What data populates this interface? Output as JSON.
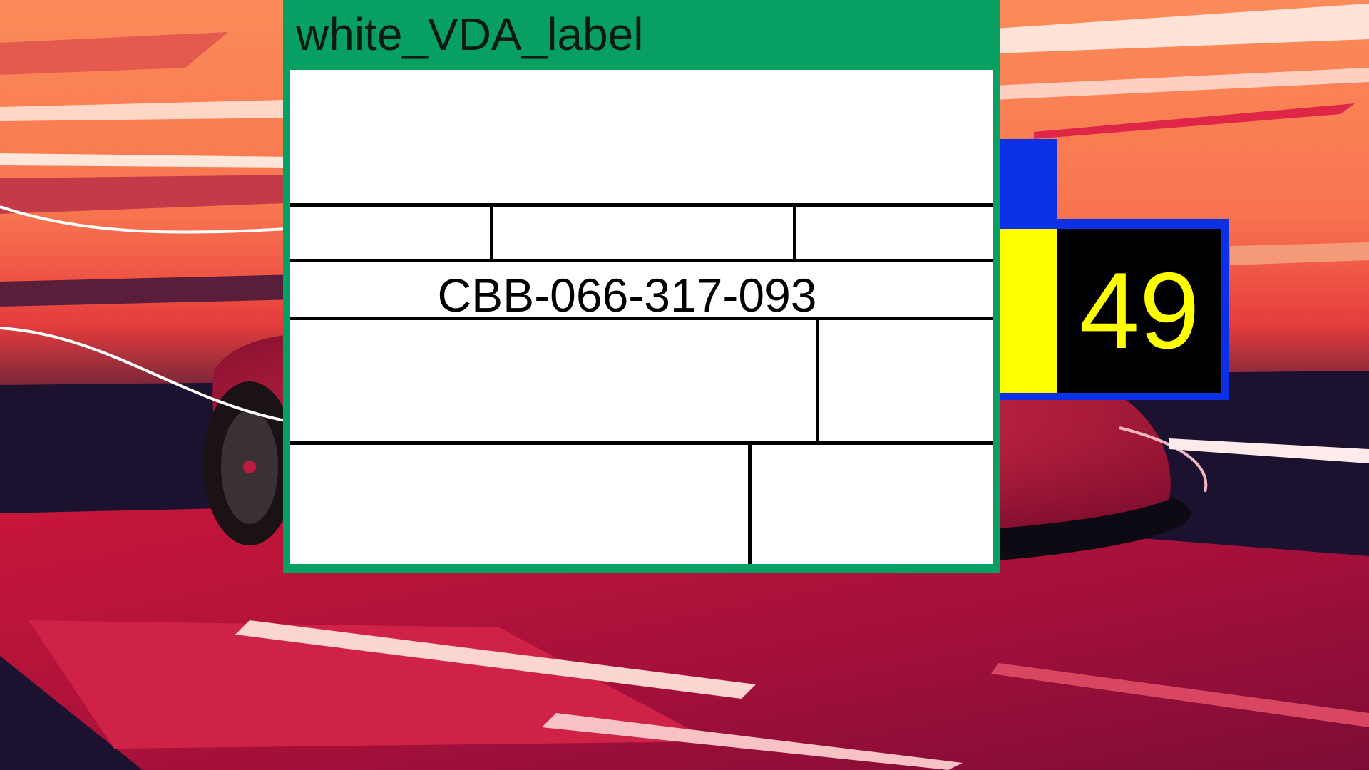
{
  "label": {
    "title": "white_VDA_label",
    "serial": "CBB-066-317-093"
  },
  "badge": {
    "number": "49"
  },
  "colors": {
    "panel_green": "#08a062",
    "badge_blue": "#0b30e6",
    "badge_yellow": "#ffff00",
    "badge_black": "#000000",
    "card_white": "#ffffff"
  },
  "icons": {
    "background": "racing-car-illustration"
  }
}
